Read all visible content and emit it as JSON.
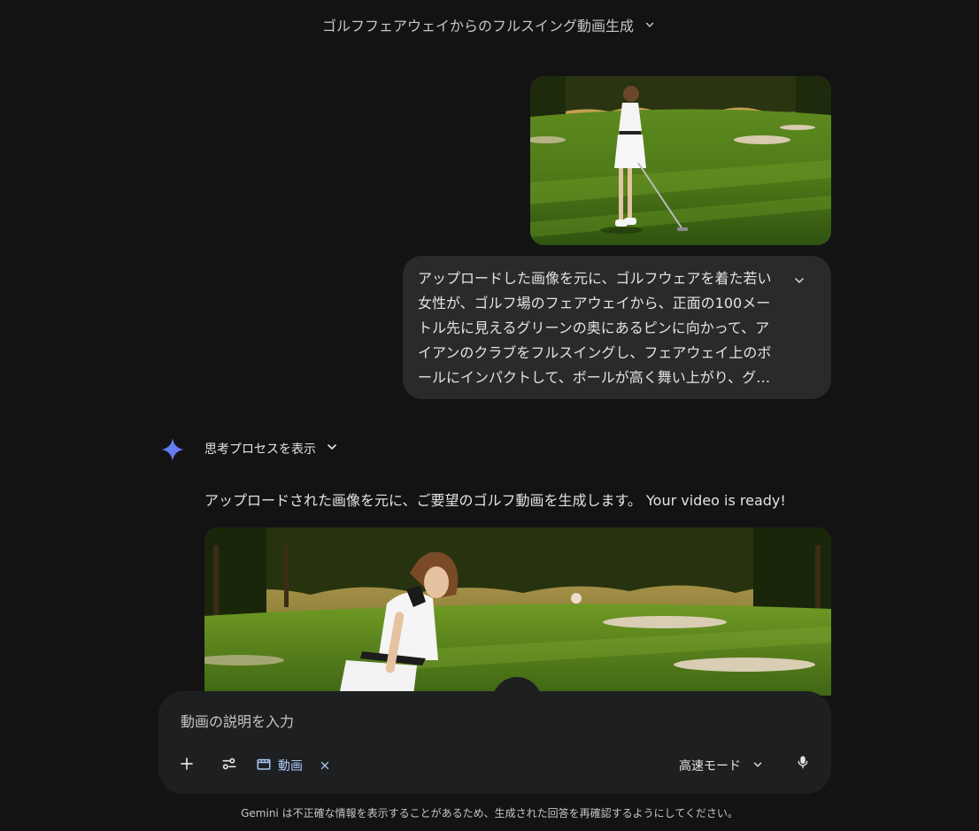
{
  "header": {
    "title": "ゴルフフェアウェイからのフルスイング動画生成",
    "chevron_icon": "chevron-down-icon"
  },
  "user_message": {
    "image_alt_icon": "uploaded-photo",
    "text": "アップロードした画像を元に、ゴルフウェアを着た若い女性が、ゴルフ場のフェアウェイから、正面の100メートル先に見えるグリーンの奥にあるピンに向かって、アイアンのクラブをフルスイングし、フェアウェイ上のボールにインパクトして、ボールが高く舞い上がり、グリー…",
    "expand_icon": "chevron-down-icon"
  },
  "response": {
    "avatar_icon": "gemini-sparkle-icon",
    "thinking_label": "思考プロセスを表示",
    "text": "アップロードされた画像を元に、ご要望のゴルフ動画を生成します。 Your video is ready!"
  },
  "input": {
    "placeholder": "動画の説明を入力",
    "value": "",
    "add_icon": "plus-icon",
    "tools_icon": "tune-icon",
    "chip_icon": "clapperboard-icon",
    "chip_label": "動画",
    "chip_close_icon": "close-icon",
    "mode_label": "高速モード",
    "mic_icon": "microphone-icon"
  },
  "colors": {
    "background": "#131314",
    "bubble": "#282a2c",
    "input": "#1e1f20",
    "accent": "#a8c7fa"
  },
  "footer": {
    "disclaimer": "Gemini は不正確な情報を表示することがあるため、生成された回答を再確認するようにしてください。"
  }
}
